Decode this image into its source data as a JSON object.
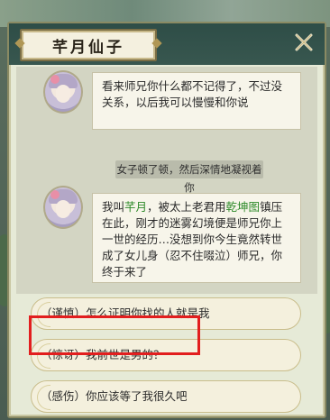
{
  "dialog": {
    "title": "芊月仙子",
    "close_icon": "close-x-icon"
  },
  "messages": [
    {
      "speaker_avatar": "fairy-avatar",
      "text": "看来师兄你什么都不记得了，不过没关系，以后我可以慢慢和你说"
    },
    {
      "narration": "女子顿了顿，然后深情地凝视着你"
    },
    {
      "speaker_avatar": "fairy-avatar",
      "text_parts": [
        "我叫",
        "芊月",
        "，被太上老君用",
        "乾坤图",
        "镇压在此，刚才的迷雾幻境便是师兄你上一世的经历…没想到你今生竟然转世成了女儿身（忍不住啜泣）师兄，你终于来了"
      ]
    }
  ],
  "choices": [
    {
      "label": "（谨慎）怎么证明你找的人就是我"
    },
    {
      "label": "（惊讶）我前世是男的？",
      "highlighted": true
    },
    {
      "label": "（感伤）你应该等了我很久吧"
    }
  ],
  "colors": {
    "highlight_text": "#2e8a2a",
    "highlight_frame": "#e21e1e",
    "panel_header": "#2e4d47"
  }
}
